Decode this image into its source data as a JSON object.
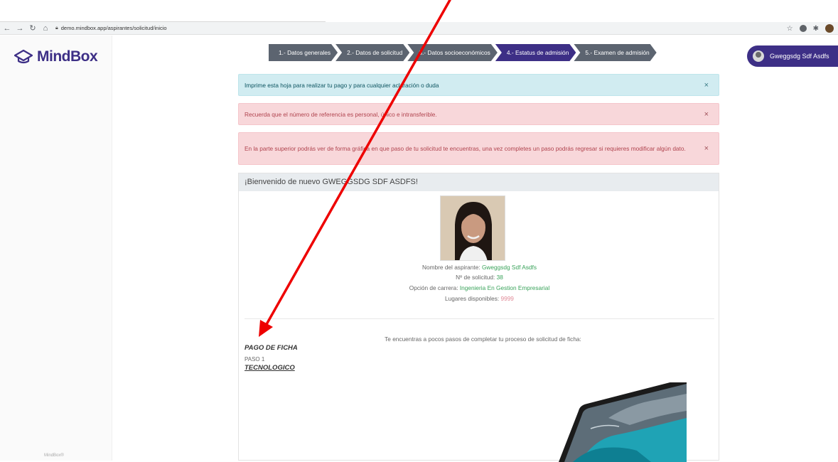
{
  "browser": {
    "url": "demo.mindbox.app/aspirantes/solicitud/inicio"
  },
  "brand": {
    "name": "MindBox",
    "footer": "MindBox®",
    "accent": "#3d2f86"
  },
  "steps": [
    {
      "label": "1.- Datos generales",
      "active": false
    },
    {
      "label": "2.- Datos de solicitud",
      "active": false
    },
    {
      "label": "3.- Datos socioeconómicos",
      "active": false
    },
    {
      "label": "4.- Estatus de admisión",
      "active": true
    },
    {
      "label": "5.- Examen de admisión",
      "active": false
    }
  ],
  "user": {
    "name": "Gweggsdg Sdf Asdfs"
  },
  "alerts": {
    "info": "Imprime esta hoja para realizar tu pago y para cualquier aclaración o duda",
    "danger1": "Recuerda que el número de referencia es personal, único e intransferible.",
    "danger2": "En la parte superior podrás ver de forma gráfica en que paso de tu solicitud te encuentras, una vez completes un paso podrás regresar si requieres modificar algún dato.",
    "close_symbol": "×"
  },
  "card": {
    "header": "¡Bienvenido de nuevo GWEGGSDG SDF ASDFS!",
    "applicant_label": "Nombre del aspirante:",
    "applicant_value": "Gweggsdg Sdf Asdfs",
    "request_label": "Nº de solicitud:",
    "request_value": "38",
    "career_label": "Opción de carrera:",
    "career_value": "Ingenieria En Gestion Empresarial",
    "places_label": "Lugares disponibles:",
    "places_value": "9999",
    "steps_message": "Te encuentras a pocos pasos de completar tu proceso de solicitud de ficha:",
    "ficha_title": "PAGO DE FICHA",
    "ficha_step": "PASO 1",
    "ficha_tec": "TECNOLOGICO"
  },
  "annotation": {
    "arrow_color": "#ee0000"
  }
}
